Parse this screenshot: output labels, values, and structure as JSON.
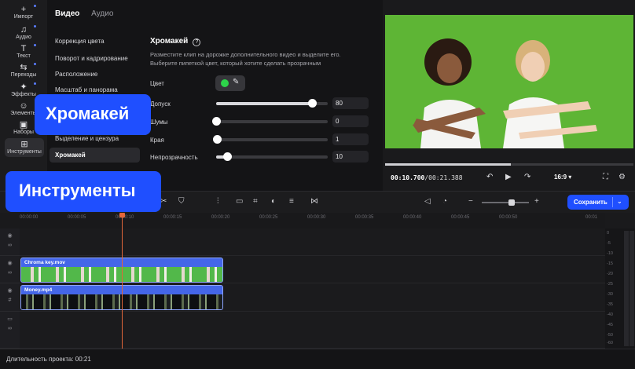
{
  "left_toolbar": {
    "items": [
      {
        "label": "Импорт",
        "icon": "plus-icon"
      },
      {
        "label": "Аудио",
        "icon": "music-note-icon"
      },
      {
        "label": "Текст",
        "icon": "text-icon"
      },
      {
        "label": "Переходы",
        "icon": "transitions-icon"
      },
      {
        "label": "Эффекты",
        "icon": "sparkle-icon"
      },
      {
        "label": "Элементы",
        "icon": "smile-icon"
      },
      {
        "label": "Наборы",
        "icon": "bag-icon"
      },
      {
        "label": "Инструменты",
        "icon": "tools-icon"
      }
    ]
  },
  "panel": {
    "tabs": [
      "Видео",
      "Аудио"
    ],
    "menu": [
      "Коррекция цвета",
      "Поворот и кадрирование",
      "Расположение",
      "Масштаб и панорама",
      "Выделение и цензура",
      "Хромакей"
    ],
    "section_title": "Хромакей",
    "description": "Разместите клип на дорожке дополнительного видео и выделите его. Выберите пипеткой цвет, который хотите сделать прозрачным",
    "color_label": "Цвет",
    "key_color": "#2dd44a",
    "sliders": [
      {
        "label": "Допуск",
        "value": "80",
        "fraction": 0.86
      },
      {
        "label": "Шумы",
        "value": "0",
        "fraction": 0.0
      },
      {
        "label": "Края",
        "value": "1",
        "fraction": 0.01
      },
      {
        "label": "Непрозрачность",
        "value": "10",
        "fraction": 0.1
      }
    ]
  },
  "callouts": {
    "chromakey": "Хромакей",
    "tools": "Инструменты"
  },
  "preview": {
    "timecode_current": "00:10.700",
    "timecode_total": "/00:21.388",
    "aspect": "16:9"
  },
  "toolbar": {
    "save_label": "Сохранить"
  },
  "ruler": [
    "00:00:00",
    "00:00:05",
    "00:00:10",
    "00:00:15",
    "00:00:20",
    "00:00:25",
    "00:00:30",
    "00:00:35",
    "00:00:40",
    "00:00:45",
    "00:00:50",
    "00:01"
  ],
  "clips": [
    {
      "name": "Chroma key.mov"
    },
    {
      "name": "Money.mp4"
    }
  ],
  "meter_labels": [
    "0",
    "-5",
    "-10",
    "-15",
    "-20",
    "-25",
    "-30",
    "-35",
    "-40",
    "-45",
    "-50",
    "-60"
  ],
  "footer": {
    "duration": "Длительность проекта: 00:21"
  },
  "colors": {
    "accent": "#1f4fff",
    "playhead": "#e2673a",
    "chroma_green": "#5eb535"
  }
}
